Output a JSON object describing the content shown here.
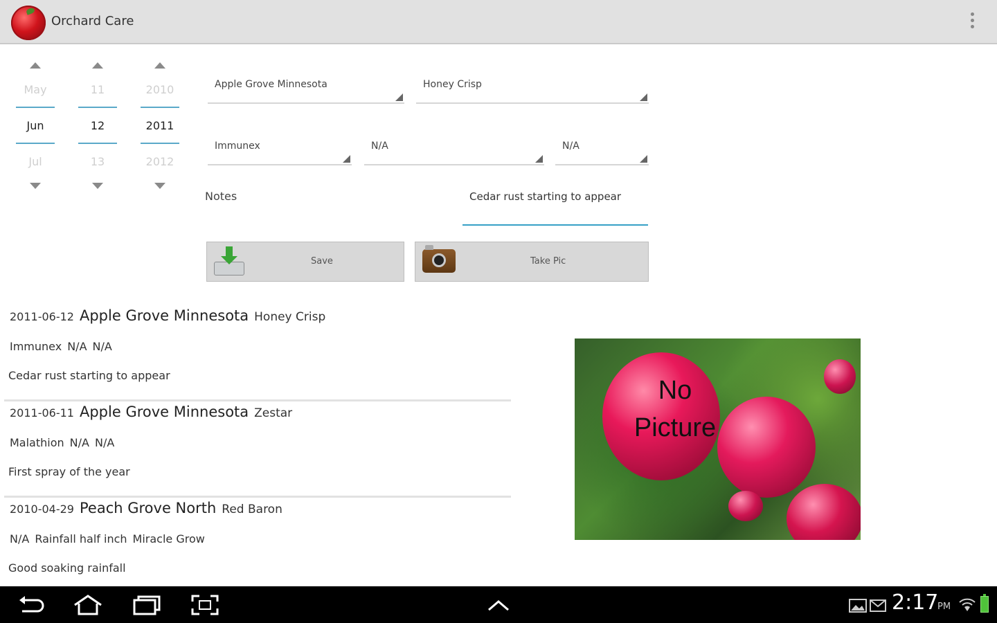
{
  "app": {
    "title": "Orchard Care"
  },
  "date_picker": {
    "month": {
      "prev": "May",
      "current": "Jun",
      "next": "Jul"
    },
    "day": {
      "prev": "11",
      "current": "12",
      "next": "13"
    },
    "year": {
      "prev": "2010",
      "current": "2011",
      "next": "2012"
    }
  },
  "form": {
    "location": "Apple Grove Minnesota",
    "variety": "Honey Crisp",
    "treatment_1": "Immunex",
    "treatment_2": "N/A",
    "treatment_3": "N/A",
    "notes_label": "Notes",
    "notes_value": "Cedar rust starting to appear",
    "save_label": "Save",
    "take_pic_label": "Take Pic"
  },
  "entries": [
    {
      "date": "2011-06-12",
      "location": "Apple Grove Minnesota",
      "variety": "Honey Crisp",
      "t1": "Immunex",
      "t2": "N/A",
      "t3": "N/A",
      "notes": "Cedar rust starting to appear"
    },
    {
      "date": "2011-06-11",
      "location": "Apple Grove Minnesota",
      "variety": "Zestar",
      "t1": "Malathion",
      "t2": "N/A",
      "t3": "N/A",
      "notes": "First spray of the year"
    },
    {
      "date": "2010-04-29",
      "location": "Peach Grove North",
      "variety": "Red Baron",
      "t1": "N/A",
      "t2": "Rainfall half inch",
      "t3": "Miracle Grow",
      "notes": "Good soaking rainfall"
    }
  ],
  "picture": {
    "placeholder_text": "No Picture"
  },
  "status_bar": {
    "time": "2:17",
    "ampm": "PM",
    "battery_color": "#4fc23a"
  },
  "icons": [
    "app-logo-icon",
    "overflow-menu-icon",
    "arrow-up-icon",
    "arrow-down-icon",
    "save-icon",
    "camera-icon",
    "back-icon",
    "home-icon",
    "recent-apps-icon",
    "screenshot-icon",
    "up-chevron-icon",
    "gallery-icon",
    "mail-icon",
    "wifi-icon",
    "battery-icon"
  ]
}
